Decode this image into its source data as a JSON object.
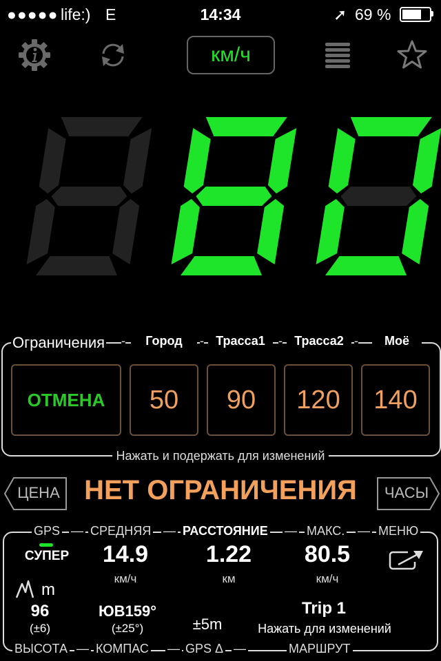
{
  "status_bar": {
    "signal": "●●●●●",
    "carrier": "life:)",
    "network": "E",
    "time": "14:34",
    "location_arrow": "➚",
    "battery": "69 %"
  },
  "toolbar": {
    "info_icon": "gear-info-icon",
    "refresh_icon": "refresh-icon",
    "unit_label": "км/ч",
    "menu_icon": "hamburger-icon",
    "favorite_icon": "star-icon"
  },
  "speed": {
    "value": "80",
    "digit_on_color": "#1fe52a",
    "digit_off_color": "#222222"
  },
  "limits": {
    "title": "Ограничения",
    "headers": [
      "Город",
      "Трасса1",
      "Трасса2",
      "Моё"
    ],
    "cancel_label": "ОТМЕНА",
    "values": [
      "50",
      "90",
      "120",
      "140"
    ],
    "hint": "Нажать и подержать для изменений"
  },
  "status_line": {
    "left_button": "ЦЕНА",
    "message": "НЕТ ОГРАНИЧЕНИЯ",
    "right_button": "ЧАСЫ"
  },
  "stats": {
    "gps_label": "GPS",
    "gps_quality": "СУПЕР",
    "average_label": "СРЕДНЯЯ",
    "average_value": "14.9",
    "average_unit": "км/ч",
    "distance_label": "РАССТОЯНИЕ",
    "distance_value": "1.22",
    "distance_unit": "км",
    "max_label": "МАКС.",
    "max_value": "80.5",
    "max_unit": "км/ч",
    "menu_label": "МЕНЮ",
    "altitude_unit": "m",
    "altitude_value": "96",
    "altitude_error": "(±6)",
    "compass_value": "ЮВ159°",
    "compass_error": "(±25°)",
    "gps_accuracy": "±5m",
    "trip_name": "Trip 1",
    "trip_hint": "Нажать для изменений",
    "altitude_caption": "ВЫСОТА",
    "compass_caption": "КОМПАС",
    "gps_delta_caption": "GPS Δ",
    "route_caption": "МАРШРУТ"
  }
}
